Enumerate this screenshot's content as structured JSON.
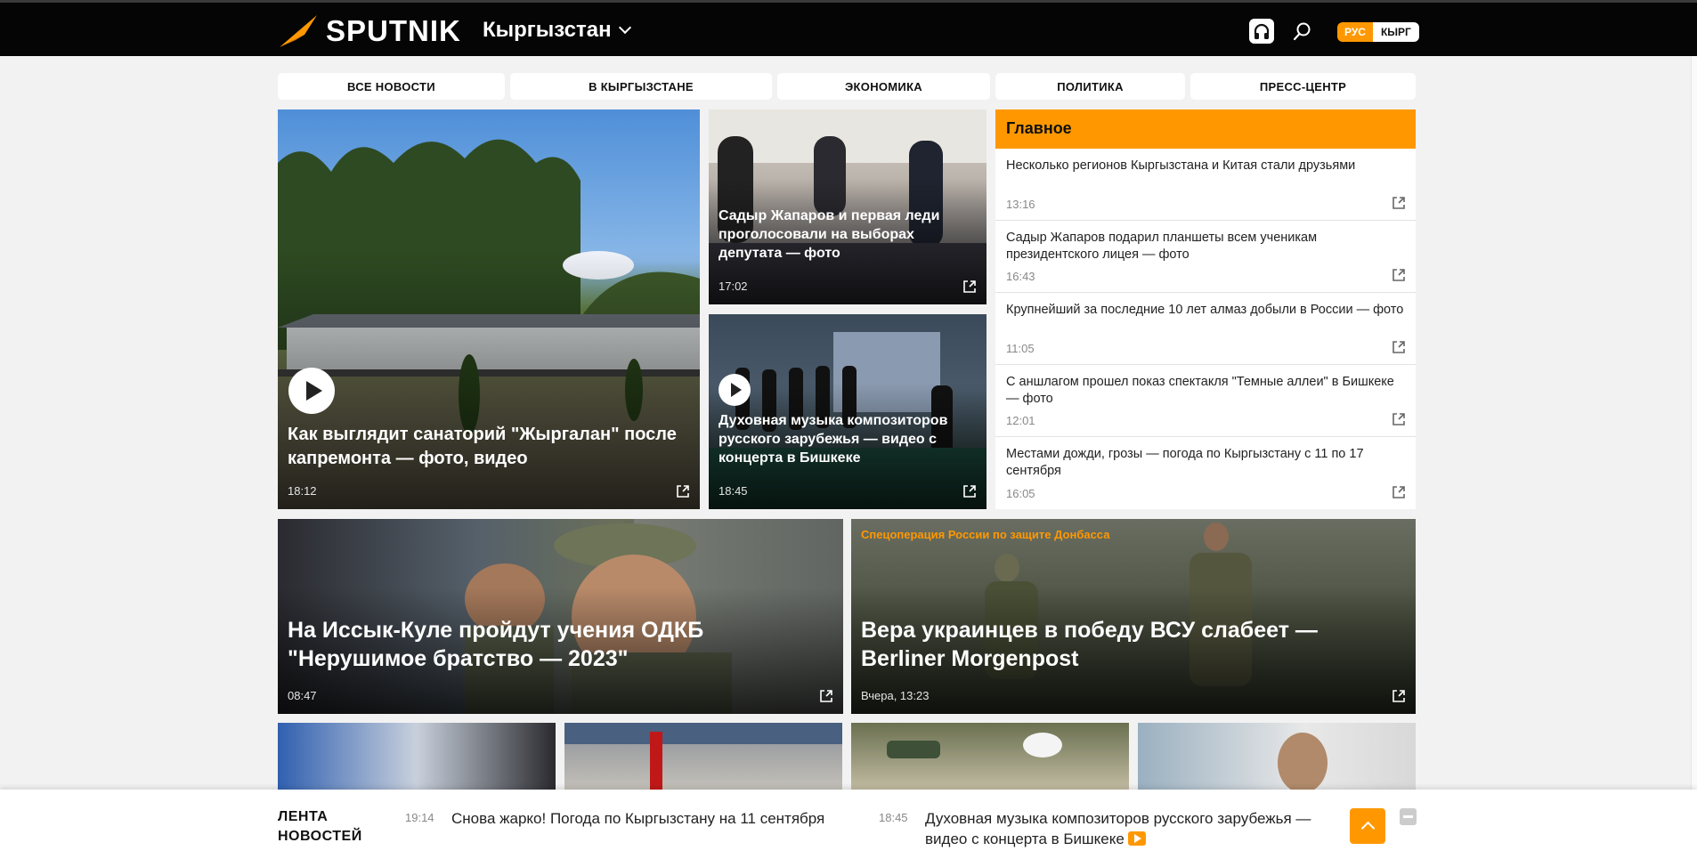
{
  "header": {
    "logo_text": "SPUTNIK",
    "region": "Кыргызстан",
    "lang_rus": "РУС",
    "lang_kyr": "КЫРГ"
  },
  "nav": [
    "ВСЕ НОВОСТИ",
    "В КЫРГЫЗСТАНЕ",
    "ЭКОНОМИКА",
    "ПОЛИТИКА",
    "ПРЕСС-ЦЕНТР"
  ],
  "cards": {
    "big": {
      "title": "Как выглядит санаторий \"Жыргалан\" после капремонта — фото, видео",
      "time": "18:12"
    },
    "top": {
      "title": "Садыр Жапаров и первая леди проголосовали на выборах депутата — фото",
      "time": "17:02"
    },
    "mid": {
      "title": "Духовная музыка композиторов русского зарубежья — видео с концерта в Бишкеке",
      "time": "18:45"
    },
    "wide_left": {
      "title": "На Иссык-Куле пройдут учения ОДКБ \"Нерушимое братство — 2023\"",
      "time": "08:47"
    },
    "wide_right": {
      "kicker": "Спецоперация России по защите Донбасса",
      "title": "Вера украинцев в победу ВСУ слабеет — Berliner Morgenpost",
      "time": "Вчера, 13:23"
    }
  },
  "main": {
    "heading": "Главное",
    "items": [
      {
        "text": "Несколько регионов Кыргызстана и Китая стали друзьями",
        "time": "13:16"
      },
      {
        "text": "Садыр Жапаров подарил планшеты всем ученикам президентского лицея — фото",
        "time": "16:43"
      },
      {
        "text": "Крупнейший за последние 10 лет алмаз добыли в России — фото",
        "time": "11:05"
      },
      {
        "text": "С аншлагом прошел показ спектакля \"Темные аллеи\" в Бишкеке — фото",
        "time": "12:01"
      },
      {
        "text": "Местами дожди, грозы — погода по Кыргызстану с 11 по 17 сентября",
        "time": "16:05"
      }
    ]
  },
  "feed": {
    "label_1": "ЛЕНТА",
    "label_2": "НОВОСТЕЙ",
    "items": [
      {
        "time": "19:14",
        "text": "Снова жарко! Погода по Кыргызстану на 11 сентября"
      },
      {
        "time": "18:45",
        "text": "Духовная музыка композиторов русского зарубежья — видео с концерта в Бишкеке"
      }
    ]
  },
  "colors": {
    "accent": "#ff9800",
    "header_bg": "#050505",
    "page_bg": "#f2f2f2"
  }
}
